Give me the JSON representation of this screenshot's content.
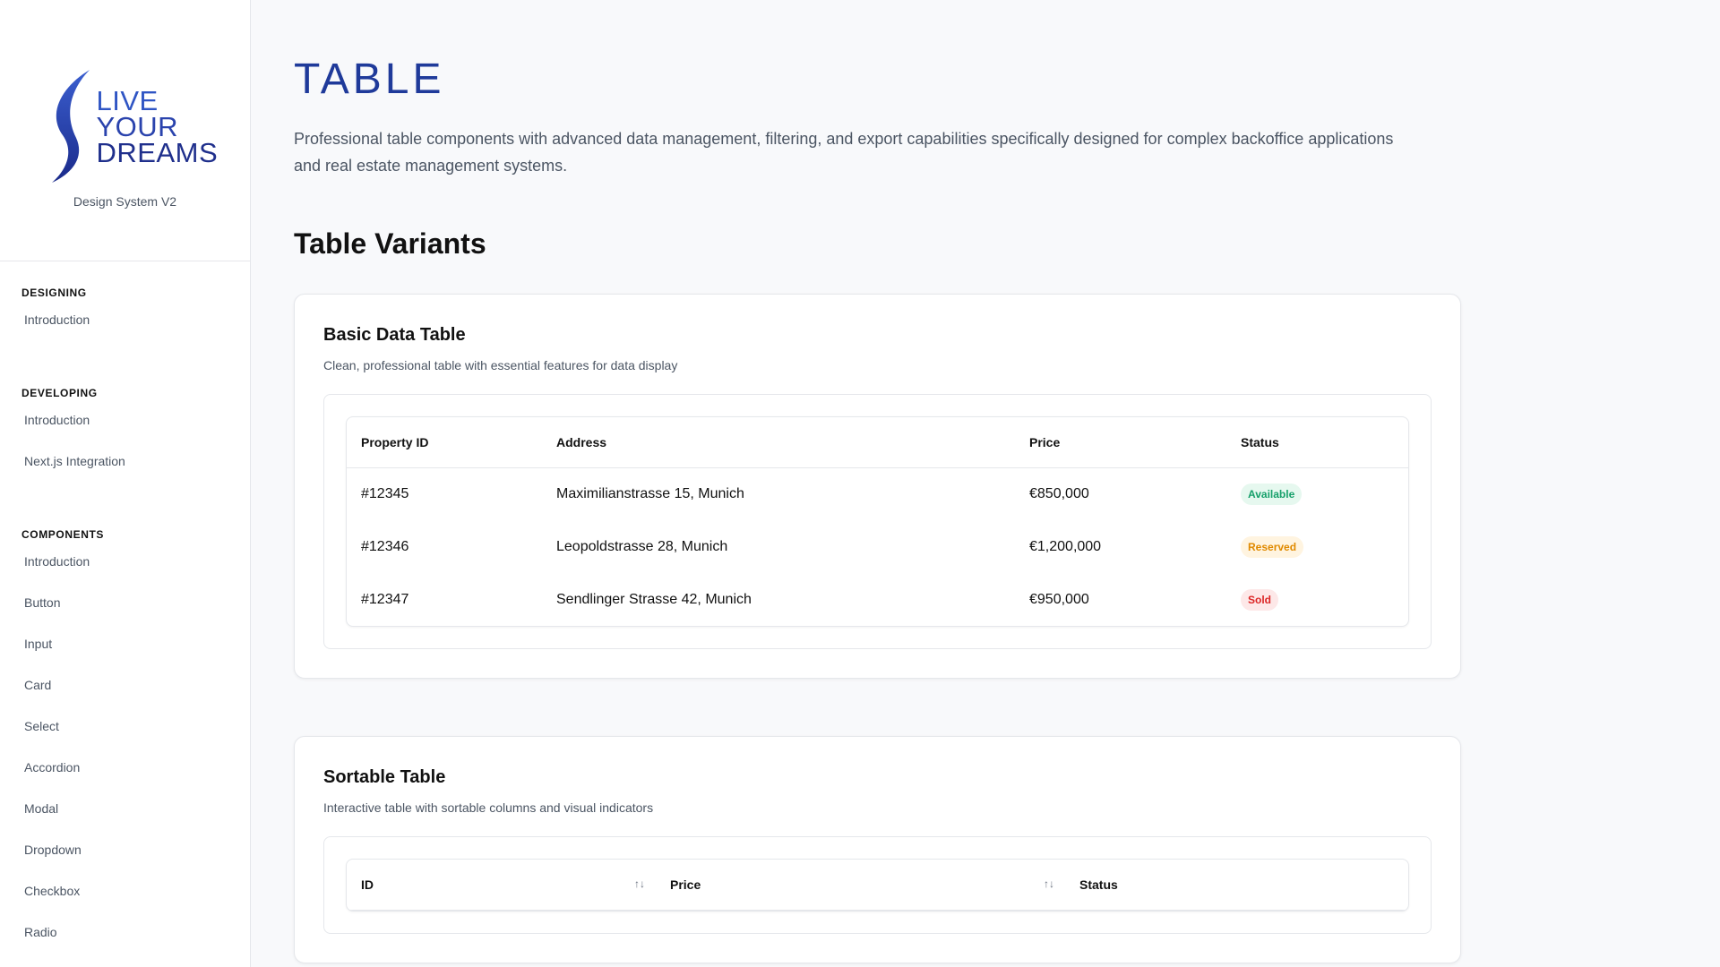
{
  "brand": {
    "logo_lines": [
      "LIVE",
      "YOUR",
      "DREAMS"
    ],
    "subtitle": "Design System V2"
  },
  "sidebar": {
    "groups": [
      {
        "title": "DESIGNING",
        "items": [
          "Introduction"
        ]
      },
      {
        "title": "DEVELOPING",
        "items": [
          "Introduction",
          "Next.js Integration"
        ]
      },
      {
        "title": "COMPONENTS",
        "items": [
          "Introduction",
          "Button",
          "Input",
          "Card",
          "Select",
          "Accordion",
          "Modal",
          "Dropdown",
          "Checkbox",
          "Radio"
        ]
      }
    ]
  },
  "page": {
    "title": "TABLE",
    "description": "Professional table components with advanced data management, filtering, and export capabilities specifically designed for complex backoffice applications and real estate management systems.",
    "section_title": "Table Variants"
  },
  "basic_table": {
    "title": "Basic Data Table",
    "description": "Clean, professional table with essential features for data display",
    "headers": [
      "Property ID",
      "Address",
      "Price",
      "Status"
    ],
    "rows": [
      {
        "id": "#12345",
        "address": "Maximilianstrasse 15, Munich",
        "price": "€850,000",
        "status": "Available"
      },
      {
        "id": "#12346",
        "address": "Leopoldstrasse 28, Munich",
        "price": "€1,200,000",
        "status": "Reserved"
      },
      {
        "id": "#12347",
        "address": "Sendlinger Strasse 42, Munich",
        "price": "€950,000",
        "status": "Sold"
      }
    ]
  },
  "sortable_table": {
    "title": "Sortable Table",
    "description": "Interactive table with sortable columns and visual indicators",
    "headers": [
      "ID",
      "Price",
      "Status"
    ],
    "sort_icon": "↑↓"
  },
  "colors": {
    "available_bg": "#e6f8ef",
    "available_fg": "#16a06a",
    "reserved_bg": "#fff4e0",
    "reserved_fg": "#e08a00",
    "sold_bg": "#fde8e8",
    "sold_fg": "#dc2626",
    "accent": "#1f3a9a"
  }
}
